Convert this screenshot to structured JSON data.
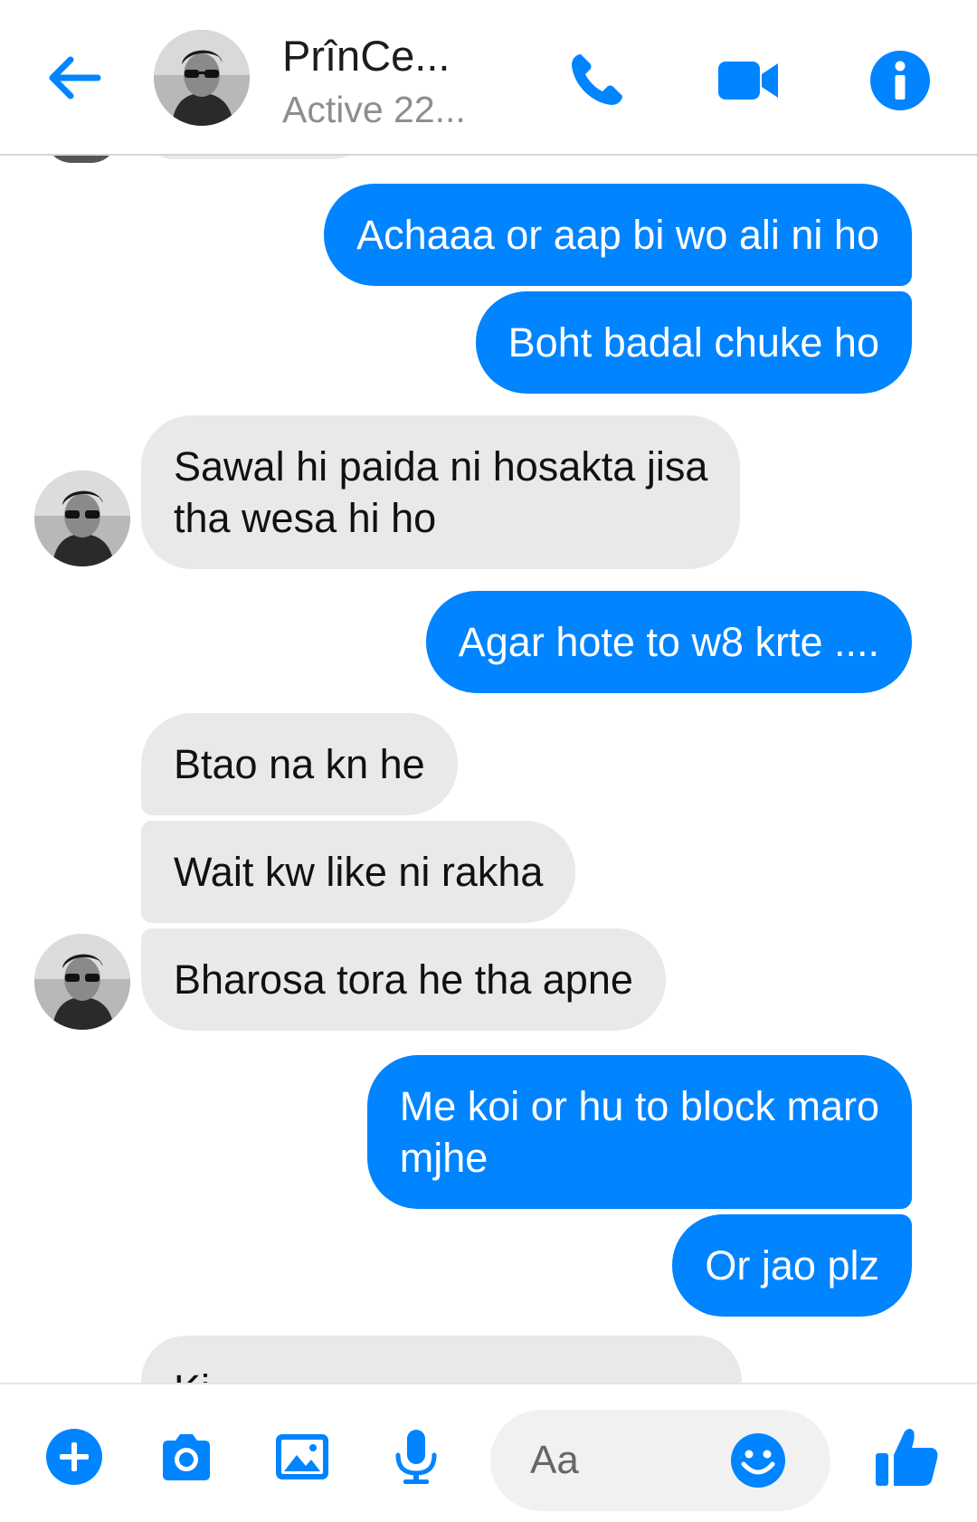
{
  "header": {
    "contact_name": "PrînCe...",
    "status": "Active 22...",
    "icons": [
      "back-arrow-icon",
      "phone-icon",
      "video-camera-icon",
      "info-icon"
    ]
  },
  "colors": {
    "accent": "#0084ff",
    "incoming_bubble": "#e9e9e9",
    "status_text": "#8e8e8e"
  },
  "messages": [
    {
      "direction": "outgoing",
      "text": "Achaaa or aap bi wo ali ni ho"
    },
    {
      "direction": "outgoing",
      "text": "Boht badal chuke ho"
    },
    {
      "direction": "incoming",
      "lines": [
        "Sawal hi paida ni hosakta jisa",
        "tha wesa hi ho"
      ]
    },
    {
      "direction": "outgoing",
      "text": "Agar hote to w8 krte ...."
    },
    {
      "direction": "incoming",
      "text": "Btao na kn he"
    },
    {
      "direction": "incoming",
      "text": "Wait kw like ni rakha"
    },
    {
      "direction": "incoming",
      "text": "Bharosa tora he tha apne"
    },
    {
      "direction": "outgoing",
      "lines": [
        "Me koi or hu to block maro",
        "mjhe"
      ]
    },
    {
      "direction": "outgoing",
      "text": "Or jao plz"
    },
    {
      "direction": "incoming",
      "text": "Ki...",
      "partially_visible": true
    }
  ],
  "composer": {
    "placeholder": "Aa",
    "icons": [
      "plus-icon",
      "camera-icon",
      "image-icon",
      "microphone-icon",
      "emoji-icon",
      "thumbs-up-icon"
    ]
  }
}
